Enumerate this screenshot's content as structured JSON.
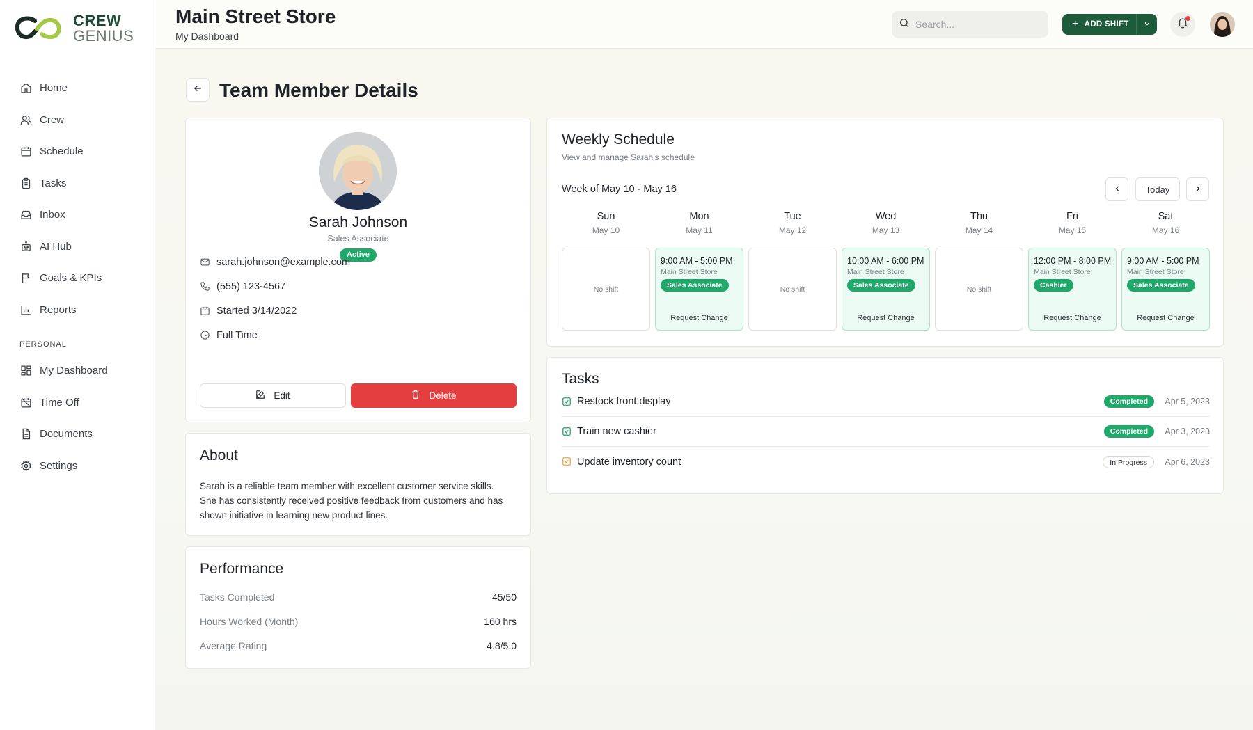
{
  "brand": {
    "line1": "CREW",
    "line2": "GENIUS"
  },
  "sidebar": {
    "items": [
      {
        "label": "Home",
        "icon": "home-icon"
      },
      {
        "label": "Crew",
        "icon": "users-icon"
      },
      {
        "label": "Schedule",
        "icon": "calendar-icon"
      },
      {
        "label": "Tasks",
        "icon": "clipboard-icon"
      },
      {
        "label": "Inbox",
        "icon": "inbox-icon"
      },
      {
        "label": "AI Hub",
        "icon": "robot-icon"
      },
      {
        "label": "Goals & KPIs",
        "icon": "flag-icon"
      },
      {
        "label": "Reports",
        "icon": "bar-chart-icon"
      }
    ],
    "section_label": "PERSONAL",
    "personal_items": [
      {
        "label": "My Dashboard",
        "icon": "dashboard-icon"
      },
      {
        "label": "Time Off",
        "icon": "calendar-off-icon"
      },
      {
        "label": "Documents",
        "icon": "document-icon"
      },
      {
        "label": "Settings",
        "icon": "gear-icon"
      }
    ]
  },
  "header": {
    "title": "Main Street Store",
    "subtitle": "My Dashboard",
    "search_placeholder": "Search...",
    "add_shift_label": "ADD SHIFT"
  },
  "page": {
    "title": "Team Member Details"
  },
  "profile": {
    "name": "Sarah Johnson",
    "role": "Sales Associate",
    "status": "Active",
    "email": "sarah.johnson@example.com",
    "phone": "(555) 123-4567",
    "started": "Started 3/14/2022",
    "employment": "Full Time",
    "edit_label": "Edit",
    "delete_label": "Delete"
  },
  "about": {
    "title": "About",
    "text": "Sarah is a reliable team member with excellent customer service skills. She has consistently received positive feedback from customers and has shown initiative in learning new product lines."
  },
  "performance": {
    "title": "Performance",
    "rows": [
      {
        "label": "Tasks Completed",
        "value": "45/50"
      },
      {
        "label": "Hours Worked (Month)",
        "value": "160 hrs"
      },
      {
        "label": "Average Rating",
        "value": "4.8/5.0"
      }
    ]
  },
  "schedule": {
    "title": "Weekly Schedule",
    "subtitle": "View and manage Sarah's schedule",
    "week_label": "Week of May 10 - May 16",
    "today_label": "Today",
    "no_shift_label": "No shift",
    "request_label": "Request Change",
    "days": [
      {
        "name": "Sun",
        "date": "May 10",
        "shift": null
      },
      {
        "name": "Mon",
        "date": "May 11",
        "shift": {
          "time": "9:00 AM - 5:00 PM",
          "location": "Main Street Store",
          "role": "Sales Associate"
        }
      },
      {
        "name": "Tue",
        "date": "May 12",
        "shift": null
      },
      {
        "name": "Wed",
        "date": "May 13",
        "shift": {
          "time": "10:00 AM - 6:00 PM",
          "location": "Main Street Store",
          "role": "Sales Associate"
        }
      },
      {
        "name": "Thu",
        "date": "May 14",
        "shift": null
      },
      {
        "name": "Fri",
        "date": "May 15",
        "shift": {
          "time": "12:00 PM - 8:00 PM",
          "location": "Main Street Store",
          "role": "Cashier"
        }
      },
      {
        "name": "Sat",
        "date": "May 16",
        "shift": {
          "time": "9:00 AM - 5:00 PM",
          "location": "Main Street Store",
          "role": "Sales Associate"
        }
      }
    ]
  },
  "tasks": {
    "title": "Tasks",
    "items": [
      {
        "name": "Restock front display",
        "status": "Completed",
        "date": "Apr 5, 2023"
      },
      {
        "name": "Train new cashier",
        "status": "Completed",
        "date": "Apr 3, 2023"
      },
      {
        "name": "Update inventory count",
        "status": "In Progress",
        "date": "Apr 6, 2023"
      }
    ]
  },
  "colors": {
    "brand_green": "#1d5b3b",
    "success": "#1fa86a",
    "danger": "#e53e3e",
    "warning": "#e8a33a"
  }
}
